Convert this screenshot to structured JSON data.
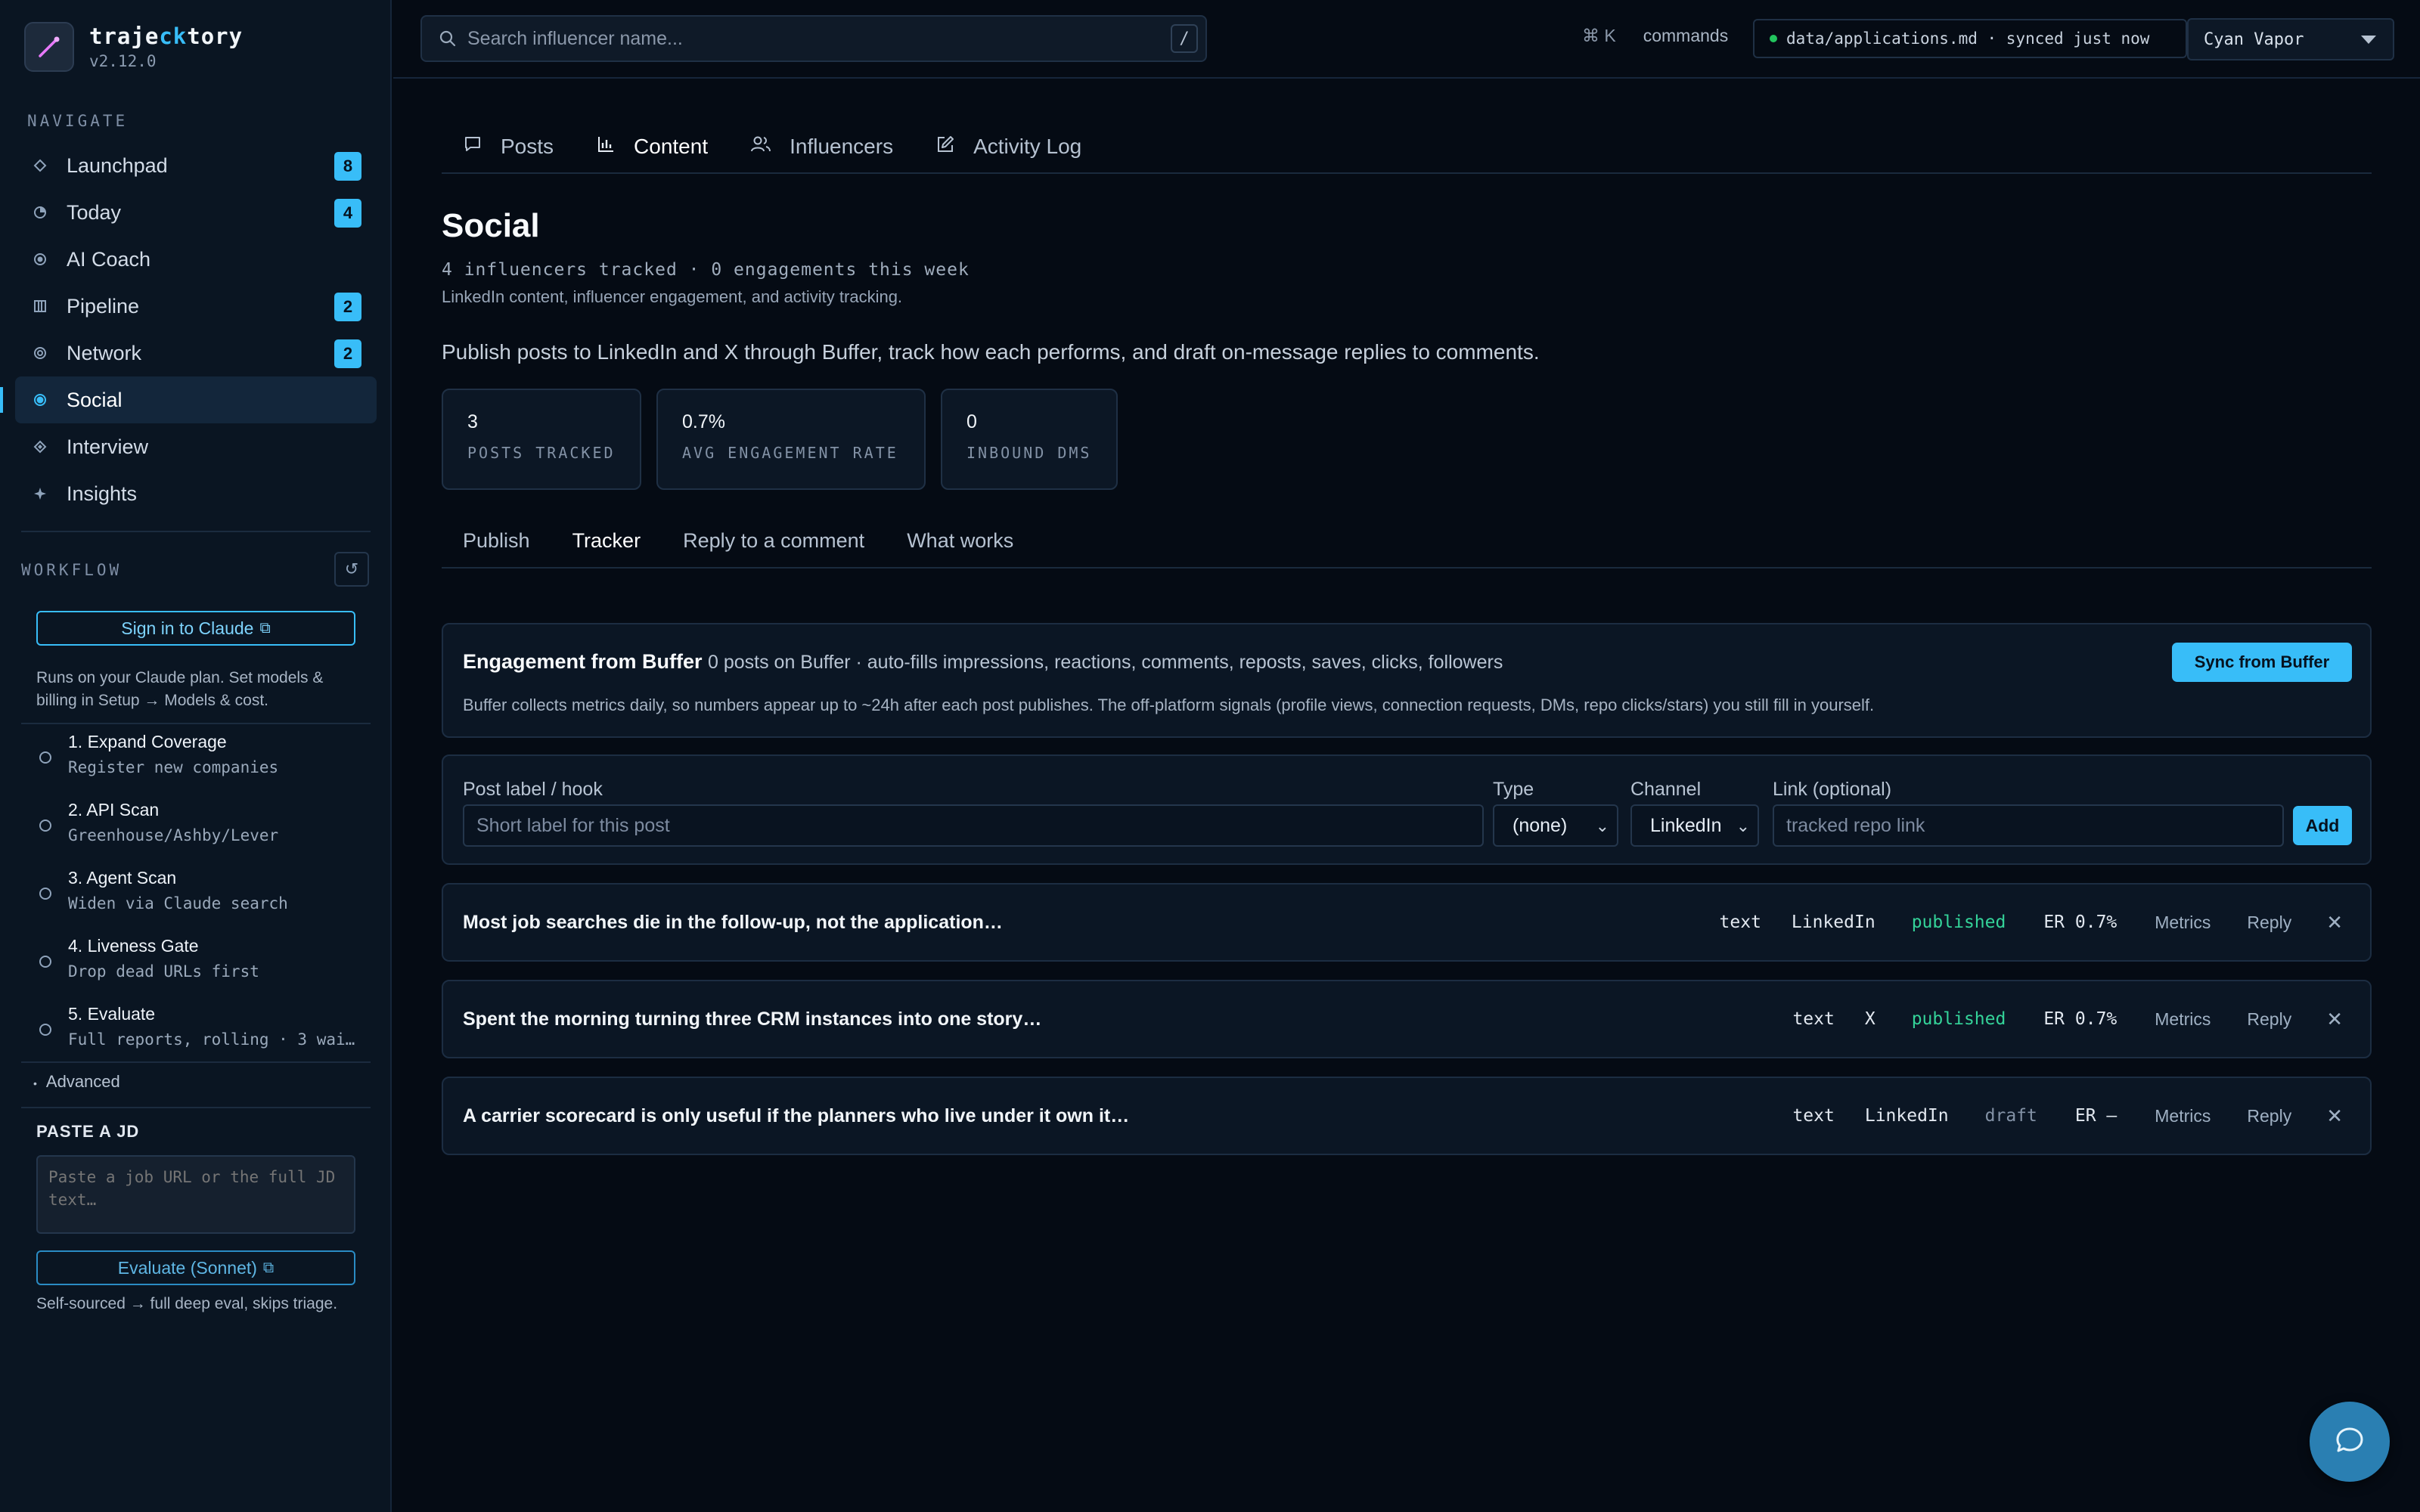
{
  "app": {
    "name_prefix": "traje",
    "name_accent": "ck",
    "name_suffix": "tory",
    "version": "v2.12.0"
  },
  "sidebar": {
    "nav_label": "NAVIGATE",
    "nav": [
      {
        "label": "Launchpad",
        "icon": "diamond-icon",
        "badge": "8"
      },
      {
        "label": "Today",
        "icon": "clock-icon",
        "badge": "4"
      },
      {
        "label": "AI Coach",
        "icon": "dot-icon",
        "badge": ""
      },
      {
        "label": "Pipeline",
        "icon": "columns-icon",
        "badge": "2"
      },
      {
        "label": "Network",
        "icon": "ring-icon",
        "badge": "2"
      },
      {
        "label": "Social",
        "icon": "dot-icon",
        "badge": "",
        "active": true
      },
      {
        "label": "Interview",
        "icon": "rhombus-icon",
        "badge": ""
      },
      {
        "label": "Insights",
        "icon": "sparkle-icon",
        "badge": ""
      }
    ],
    "workflow_label": "WORKFLOW",
    "sign_in_label": "Sign in to Claude",
    "plan_note_line1": "Runs on your Claude plan. Set models &",
    "plan_note_line2": "billing in Setup → Models & cost.",
    "steps": [
      {
        "title": "1. Expand Coverage",
        "sub": "Register new companies"
      },
      {
        "title": "2. API Scan",
        "sub": "Greenhouse/Ashby/Lever"
      },
      {
        "title": "3. Agent Scan",
        "sub": "Widen via Claude search"
      },
      {
        "title": "4. Liveness Gate",
        "sub": "Drop dead URLs first"
      },
      {
        "title": "5. Evaluate",
        "sub": "Full reports, rolling · 3 wai…"
      }
    ],
    "advanced_label": "Advanced",
    "paste_label": "PASTE A JD",
    "paste_placeholder": "Paste a job URL or the full JD text…",
    "evaluate_label": "Evaluate (Sonnet)",
    "evaluate_note": "Self-sourced → full deep eval, skips triage."
  },
  "topbar": {
    "search_placeholder": "Search influencer name...",
    "search_shortcut": "/",
    "cmd_key": "⌘ K",
    "cmd_label": "commands",
    "file_status": "data/applications.md · synced just now",
    "theme": "Cyan Vapor"
  },
  "main": {
    "tabs": [
      {
        "label": "Posts",
        "icon": "message-icon"
      },
      {
        "label": "Content",
        "icon": "bar-chart-icon",
        "active": true
      },
      {
        "label": "Influencers",
        "icon": "users-icon"
      },
      {
        "label": "Activity Log",
        "icon": "edit-icon"
      }
    ],
    "title": "Social",
    "subtitle": "4 influencers tracked · 0 engagements this week",
    "description": "LinkedIn content, influencer engagement, and activity tracking.",
    "lead": "Publish posts to LinkedIn and X through Buffer, track how each performs, and draft on-message replies to comments.",
    "stats": [
      {
        "value": "3",
        "label": "POSTS TRACKED"
      },
      {
        "value": "0.7%",
        "label": "AVG ENGAGEMENT RATE"
      },
      {
        "value": "0",
        "label": "INBOUND DMS"
      }
    ],
    "subtabs": [
      {
        "label": "Publish"
      },
      {
        "label": "Tracker",
        "active": true
      },
      {
        "label": "Reply to a comment"
      },
      {
        "label": "What works"
      }
    ],
    "engagement": {
      "title": "Engagement from Buffer",
      "meta": "0 posts on Buffer · auto-fills impressions, reactions, comments, reposts, saves, clicks, followers",
      "note": "Buffer collects metrics daily, so numbers appear up to ~24h after each post publishes. The off-platform signals (profile views, connection requests, DMs, repo clicks/stars) you still fill in yourself.",
      "sync_label": "Sync from Buffer"
    },
    "form": {
      "label_label": "Post label / hook",
      "label_placeholder": "Short label for this post",
      "type_label": "Type",
      "type_value": "(none)",
      "channel_label": "Channel",
      "channel_value": "LinkedIn",
      "link_label": "Link (optional)",
      "link_placeholder": "tracked repo link",
      "add_label": "Add"
    },
    "posts": [
      {
        "title": "Most job searches die in the follow-up, not the application…",
        "type": "text",
        "channel": "LinkedIn",
        "status": "published",
        "er": "ER 0.7%",
        "metrics": "Metrics",
        "reply": "Reply",
        "remove": "✕"
      },
      {
        "title": "Spent the morning turning three CRM instances into one story…",
        "type": "text",
        "channel": "X",
        "status": "published",
        "er": "ER 0.7%",
        "metrics": "Metrics",
        "reply": "Reply",
        "remove": "✕"
      },
      {
        "title": "A carrier scorecard is only useful if the planners who live under it own it…",
        "type": "text",
        "channel": "LinkedIn",
        "status": "draft",
        "er": "ER —",
        "metrics": "Metrics",
        "reply": "Reply",
        "remove": "✕"
      }
    ]
  },
  "colors": {
    "accent": "#38bdf8",
    "background": "#050b14",
    "sidebar": "#0a1522",
    "published": "#34d399",
    "fab": "#2a7fb2"
  }
}
